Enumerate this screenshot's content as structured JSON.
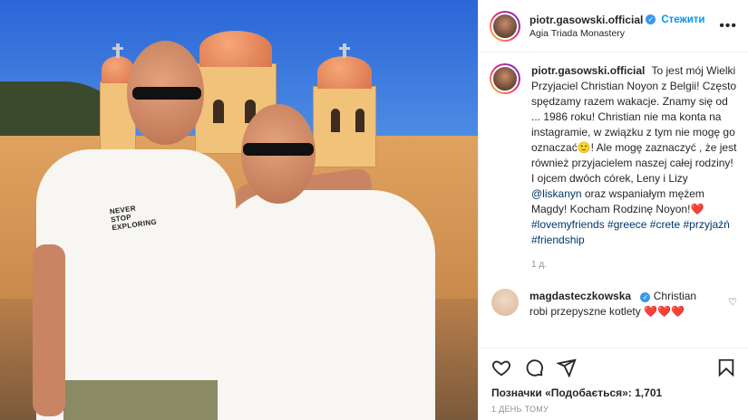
{
  "post": {
    "username": "piotr.gasowski.official",
    "follow_label": "Стежити",
    "location": "Agia Triada Monastery",
    "more_label": "•••"
  },
  "caption": {
    "username": "piotr.gasowski.official",
    "text_1": "To jest mój Wielki Przyjaciel Christian Noyon z Belgii! Często spędzamy razem wakacje. Znamy się od ... 1986 roku! Christian nie ma konta na instagramie, w związku z tym nie mogę go oznaczać",
    "emoji_1": "🙂",
    "text_2": "! Ale mogę zaznaczyć , że jest również przyjacielem naszej całej rodziny! I ojcem dwóch córek, Leny i Lizy ",
    "mention": "@liskanyn",
    "text_3": " oraz wspaniałym mężem Magdy! Kocham Rodzinę Noyon!",
    "emoji_2": "❤️",
    "hashtags": [
      "#lovemyfriends",
      "#greece",
      "#crete",
      "#przyjaźń",
      "#friendship"
    ],
    "time": "1 д."
  },
  "comment": {
    "username": "magdasteczkowska",
    "text": "Christian robi przepyszne kotlety",
    "hearts": "❤️❤️❤️",
    "heart_icon": "♡"
  },
  "footer": {
    "likes": "Позначки «Подобається»: 1,701",
    "date": "1 ДЕНЬ ТОМУ"
  },
  "shirt_text": "NEVER STOP EXPLORING",
  "icons": [
    "heart-icon",
    "comment-icon",
    "share-icon",
    "bookmark-icon",
    "verified-icon"
  ],
  "colors": {
    "accent": "#0095f6",
    "verified": "#3897f0",
    "link": "#00376b",
    "heart": "#ed4956"
  }
}
